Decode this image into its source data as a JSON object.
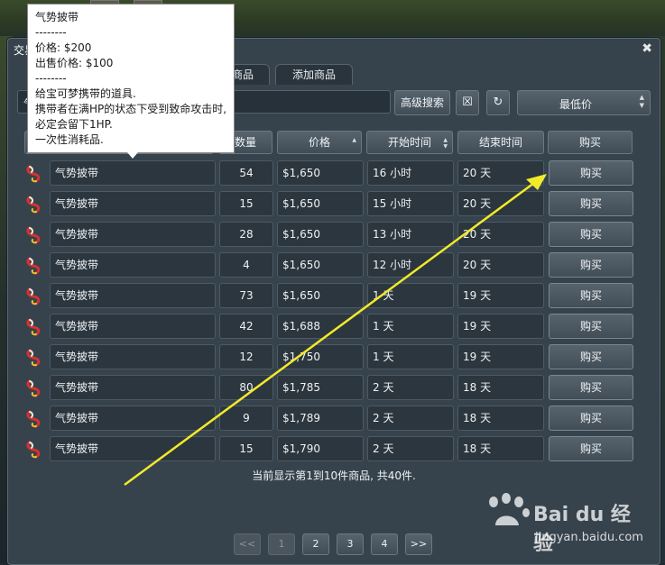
{
  "window": {
    "title": "交易",
    "close": "✖"
  },
  "tabs": [
    {
      "label": "商品"
    },
    {
      "label": "添加商品"
    }
  ],
  "search": {
    "value": "气"
  },
  "buttons": {
    "advanced": "高级搜索",
    "clear": "☒",
    "refresh": "↻"
  },
  "sort": {
    "selected": "最低价"
  },
  "columns": {
    "quantity": "数量",
    "price": "价格",
    "start_time": "开始时间",
    "end_time": "结束时间",
    "buy": "购买"
  },
  "rows": [
    {
      "name": "气势披带",
      "qty": "54",
      "price": "$1,650",
      "start": "16 小时",
      "end": "20 天",
      "buy": "购买"
    },
    {
      "name": "气势披带",
      "qty": "15",
      "price": "$1,650",
      "start": "15 小时",
      "end": "20 天",
      "buy": "购买"
    },
    {
      "name": "气势披带",
      "qty": "28",
      "price": "$1,650",
      "start": "13 小时",
      "end": "20 天",
      "buy": "购买"
    },
    {
      "name": "气势披带",
      "qty": "4",
      "price": "$1,650",
      "start": "12 小时",
      "end": "20 天",
      "buy": "购买"
    },
    {
      "name": "气势披带",
      "qty": "73",
      "price": "$1,650",
      "start": "1 天",
      "end": "19 天",
      "buy": "购买"
    },
    {
      "name": "气势披带",
      "qty": "42",
      "price": "$1,688",
      "start": "1 天",
      "end": "19 天",
      "buy": "购买"
    },
    {
      "name": "气势披带",
      "qty": "12",
      "price": "$1,750",
      "start": "1 天",
      "end": "19 天",
      "buy": "购买"
    },
    {
      "name": "气势披带",
      "qty": "80",
      "price": "$1,785",
      "start": "2 天",
      "end": "18 天",
      "buy": "购买"
    },
    {
      "name": "气势披带",
      "qty": "9",
      "price": "$1,789",
      "start": "2 天",
      "end": "18 天",
      "buy": "购买"
    },
    {
      "name": "气势披带",
      "qty": "15",
      "price": "$1,790",
      "start": "2 天",
      "end": "18 天",
      "buy": "购买"
    }
  ],
  "summary": "当前显示第1到10件商品, 共40件.",
  "pagination": {
    "first": "<<",
    "pages": [
      "1",
      "2",
      "3",
      "4"
    ],
    "next": ">>"
  },
  "tooltip": {
    "lines": [
      "气势披带",
      "--------",
      "价格: $200",
      "出售价格: $100",
      "--------",
      "给宝可梦携带的道具.",
      "携带者在满HP的状态下受到致命攻击时,",
      "必定会留下1HP.",
      "一次性消耗品."
    ]
  },
  "watermark": {
    "logo": "Bai du 经验",
    "url": "jingyan.baidu.com"
  },
  "colors": {
    "arrow": "#f2ea2a",
    "window_bg": "#36434d"
  }
}
